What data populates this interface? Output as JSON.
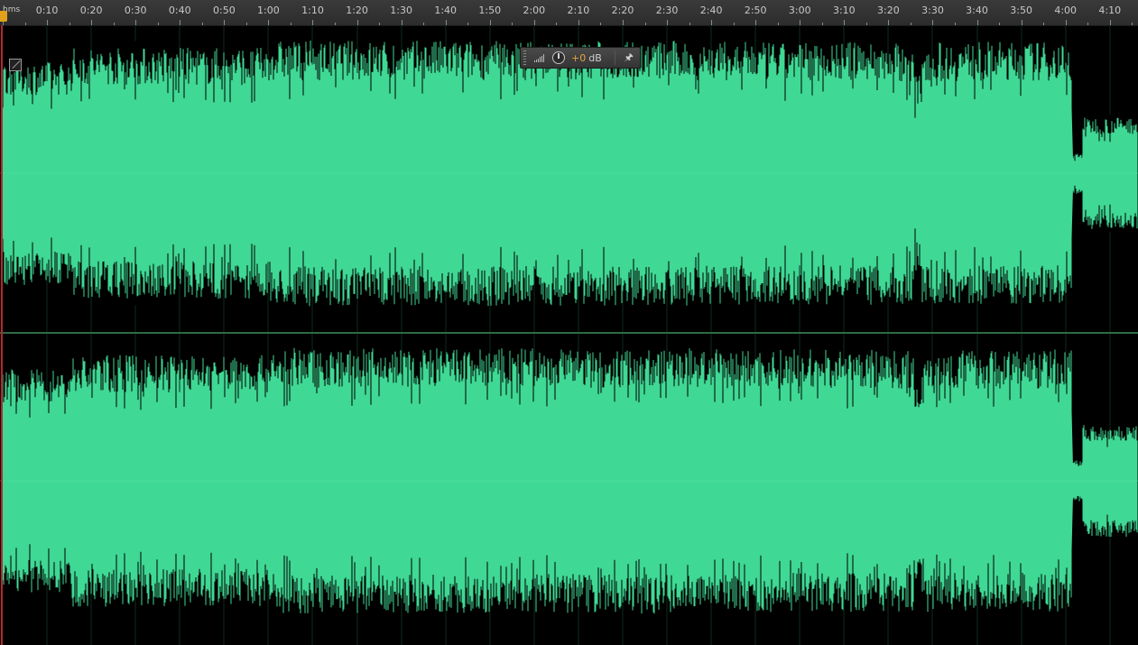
{
  "ruler": {
    "start_label": "hms",
    "labels": [
      "0:10",
      "0:20",
      "0:30",
      "0:40",
      "0:50",
      "1:00",
      "1:10",
      "1:20",
      "1:30",
      "1:40",
      "1:50",
      "2:00",
      "2:10",
      "2:20",
      "2:30",
      "2:40",
      "2:50",
      "3:00",
      "3:10",
      "3:20",
      "3:30",
      "3:40",
      "3:50",
      "4:00",
      "4:10"
    ]
  },
  "hud": {
    "gain_value": "+0",
    "gain_unit": "dB",
    "pin_icon": "pin-icon",
    "knob_icon": "volume-knob-icon",
    "level_icon": "level-meter-icon"
  },
  "colors": {
    "waveform": "#3fd894",
    "background": "#000000",
    "playhead": "#b3282d",
    "hud_value": "#e8a33d"
  }
}
